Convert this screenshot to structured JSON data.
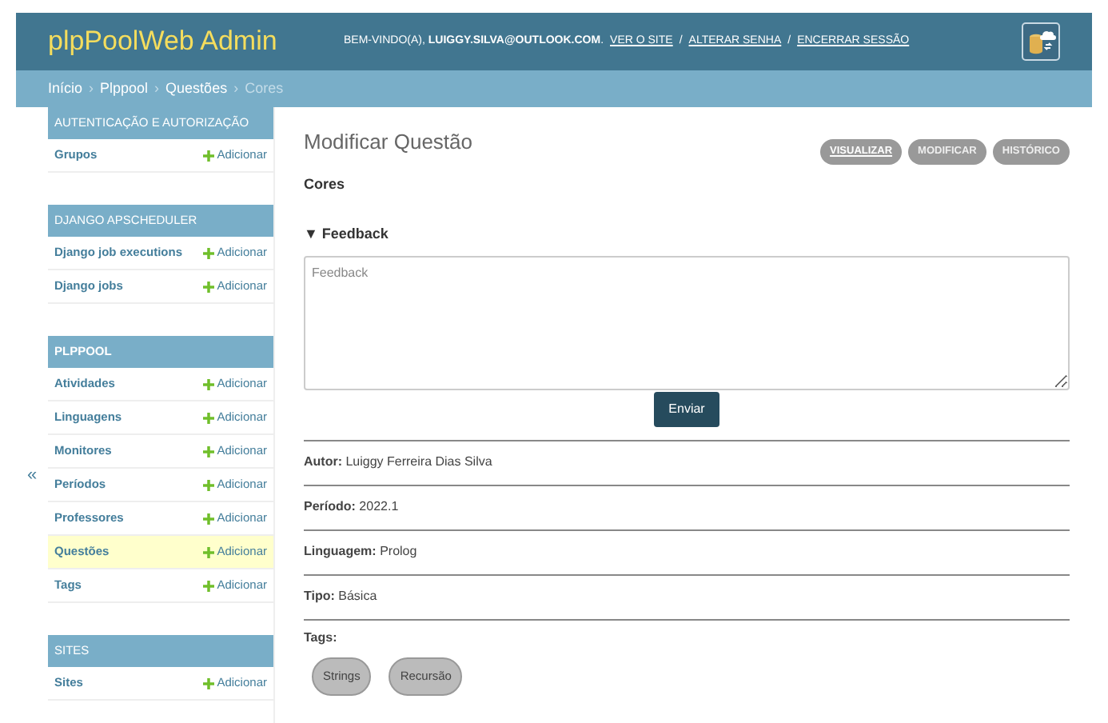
{
  "header": {
    "title": "plpPoolWeb Admin",
    "welcome": "BEM-VINDO(A), **LUIGGY.SILVA@OUTLOOK.COM**.",
    "links": [
      "VER O SITE",
      "ALTERAR SENHA",
      "ENCERRAR SESSÃO"
    ],
    "link_separator": "/"
  },
  "breadcrumb": {
    "separator": "›",
    "items": [
      {
        "label": "Início",
        "current": false
      },
      {
        "label": "Plppool",
        "current": false
      },
      {
        "label": "Questões",
        "current": false
      },
      {
        "label": "Cores",
        "current": true
      }
    ]
  },
  "sidebar": {
    "collapse": "«",
    "sections": [
      {
        "title": "AUTENTICAÇÃO E AUTORIZAÇÃO",
        "bold": false,
        "items": [
          {
            "label": "Grupos",
            "add": "Adicionar",
            "selected": false
          }
        ]
      },
      {
        "title": "DJANGO APSCHEDULER",
        "bold": false,
        "items": [
          {
            "label": "Django job executions",
            "add": "Adicionar",
            "selected": false
          },
          {
            "label": "Django jobs",
            "add": "Adicionar",
            "selected": false
          }
        ]
      },
      {
        "title": "PLPPOOL",
        "bold": true,
        "items": [
          {
            "label": "Atividades",
            "add": "Adicionar",
            "selected": false
          },
          {
            "label": "Linguagens",
            "add": "Adicionar",
            "selected": false
          },
          {
            "label": "Monitores",
            "add": "Adicionar",
            "selected": false
          },
          {
            "label": "Períodos",
            "add": "Adicionar",
            "selected": false
          },
          {
            "label": "Professores",
            "add": "Adicionar",
            "selected": false
          },
          {
            "label": "Questões",
            "add": "Adicionar",
            "selected": true
          },
          {
            "label": "Tags",
            "add": "Adicionar",
            "selected": false
          }
        ]
      },
      {
        "title": "SITES",
        "bold": false,
        "items": [
          {
            "label": "Sites",
            "add": "Adicionar",
            "selected": false
          }
        ]
      }
    ]
  },
  "content": {
    "title": "Modificar Questão",
    "subtitle": "Cores",
    "tools": [
      {
        "label": "VISUALIZAR",
        "selected": true
      },
      {
        "label": "MODIFICAR",
        "selected": false
      },
      {
        "label": "HISTÓRICO",
        "selected": false
      }
    ],
    "feedback": {
      "heading": "▼ Feedback",
      "placeholder": "Feedback",
      "button": "Enviar"
    },
    "fields": [
      "**Autor:** Luiggy Ferreira Dias Silva",
      "**Período:** 2022.1",
      "**Linguagem:** Prolog",
      "**Tipo:** Básica"
    ],
    "tags_label": "Tags:",
    "tags": [
      "Strings",
      "Recursão"
    ]
  }
}
